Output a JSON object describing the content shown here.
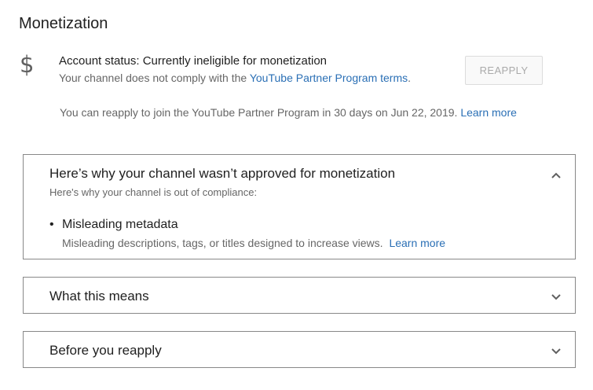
{
  "page": {
    "title": "Monetization"
  },
  "status": {
    "icon": "dollar-icon",
    "label": "Account status: Currently ineligible for monetization",
    "sub_text": "Your channel does not comply with the",
    "sub_link": "YouTube Partner Program terms",
    "sub_end": ".",
    "reapply_button": "REAPPLY",
    "note_text": "You can reapply to join the YouTube Partner Program in 30 days on Jun 22, 2019.",
    "note_link": "Learn more"
  },
  "panels": [
    {
      "title": "Here’s why your channel wasn’t approved for monetization",
      "expanded": true,
      "chevron": "chevron-up-icon",
      "subtitle": "Here's why your channel is out of compliance:",
      "items": [
        {
          "bullet": "•",
          "title": "Misleading metadata",
          "description": "Misleading descriptions, tags, or titles designed to increase views.",
          "link": "Learn more"
        }
      ]
    },
    {
      "title": "What this means",
      "expanded": false,
      "chevron": "chevron-down-icon"
    },
    {
      "title": "Before you reapply",
      "expanded": false,
      "chevron": "chevron-down-icon"
    }
  ],
  "colors": {
    "link": "#2a6fb5",
    "border": "#888888",
    "muted_text": "#666666"
  }
}
